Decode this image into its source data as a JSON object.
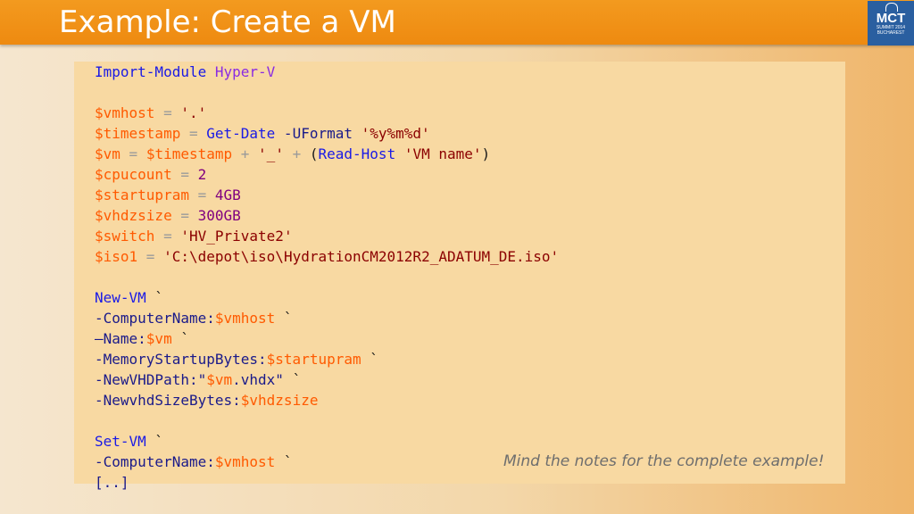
{
  "slide": {
    "title": "Example: Create a VM",
    "note": "Mind the notes for the complete example!"
  },
  "logo": {
    "line1": "MCT",
    "line2": "SUMMIT 2014",
    "line3": "BUCHAREST"
  },
  "code": [
    [
      {
        "t": "Import-Module ",
        "c": "kw"
      },
      {
        "t": "Hyper-V",
        "c": "mod"
      }
    ],
    [],
    [
      {
        "t": "$vmhost",
        "c": "var"
      },
      {
        "t": " = ",
        "c": "op"
      },
      {
        "t": "'.'",
        "c": "str"
      }
    ],
    [
      {
        "t": "$timestamp",
        "c": "var"
      },
      {
        "t": " = ",
        "c": "op"
      },
      {
        "t": "Get-Date",
        "c": "kw"
      },
      {
        "t": " -UFormat ",
        "c": "param"
      },
      {
        "t": "'%y%m%d'",
        "c": "str"
      }
    ],
    [
      {
        "t": "$vm",
        "c": "var"
      },
      {
        "t": " = ",
        "c": "op"
      },
      {
        "t": "$timestamp",
        "c": "var"
      },
      {
        "t": " + ",
        "c": "op"
      },
      {
        "t": "'_'",
        "c": "str"
      },
      {
        "t": " + ",
        "c": "op"
      },
      {
        "t": "(",
        "c": "dark"
      },
      {
        "t": "Read-Host",
        "c": "kw"
      },
      {
        "t": " ",
        "c": "dark"
      },
      {
        "t": "'VM name'",
        "c": "str"
      },
      {
        "t": ")",
        "c": "dark"
      }
    ],
    [
      {
        "t": "$cpucount",
        "c": "var"
      },
      {
        "t": " = ",
        "c": "op"
      },
      {
        "t": "2",
        "c": "num"
      }
    ],
    [
      {
        "t": "$startupram",
        "c": "var"
      },
      {
        "t": " = ",
        "c": "op"
      },
      {
        "t": "4GB",
        "c": "num"
      }
    ],
    [
      {
        "t": "$vhdzsize",
        "c": "var"
      },
      {
        "t": " = ",
        "c": "op"
      },
      {
        "t": "300GB",
        "c": "num"
      }
    ],
    [
      {
        "t": "$switch",
        "c": "var"
      },
      {
        "t": " = ",
        "c": "op"
      },
      {
        "t": "'HV_Private2'",
        "c": "str"
      }
    ],
    [
      {
        "t": "$iso1",
        "c": "var"
      },
      {
        "t": " = ",
        "c": "op"
      },
      {
        "t": "'C:\\depot\\iso\\HydrationCM2012R2_ADATUM_DE.iso'",
        "c": "str"
      }
    ],
    [],
    [
      {
        "t": "New-VM",
        "c": "kw"
      },
      {
        "t": " `",
        "c": "dark"
      }
    ],
    [
      {
        "t": "-ComputerName:",
        "c": "param"
      },
      {
        "t": "$vmhost",
        "c": "var"
      },
      {
        "t": " `",
        "c": "dark"
      }
    ],
    [
      {
        "t": "–Name:",
        "c": "param"
      },
      {
        "t": "$vm",
        "c": "var"
      },
      {
        "t": " `",
        "c": "dark"
      }
    ],
    [
      {
        "t": "-MemoryStartupBytes:",
        "c": "param"
      },
      {
        "t": "$startupram",
        "c": "var"
      },
      {
        "t": " `",
        "c": "dark"
      }
    ],
    [
      {
        "t": "-NewVHDPath:\"",
        "c": "param"
      },
      {
        "t": "$vm",
        "c": "var"
      },
      {
        "t": ".vhdx\"",
        "c": "param"
      },
      {
        "t": " `",
        "c": "dark"
      }
    ],
    [
      {
        "t": "-NewvhdSizeBytes:",
        "c": "param"
      },
      {
        "t": "$vhdzsize",
        "c": "var"
      }
    ],
    [],
    [
      {
        "t": "Set-VM",
        "c": "kw"
      },
      {
        "t": " `",
        "c": "dark"
      }
    ],
    [
      {
        "t": "-ComputerName:",
        "c": "param"
      },
      {
        "t": "$vmhost",
        "c": "var"
      },
      {
        "t": " `",
        "c": "dark"
      }
    ],
    [
      {
        "t": "[..]",
        "c": "param"
      }
    ]
  ]
}
